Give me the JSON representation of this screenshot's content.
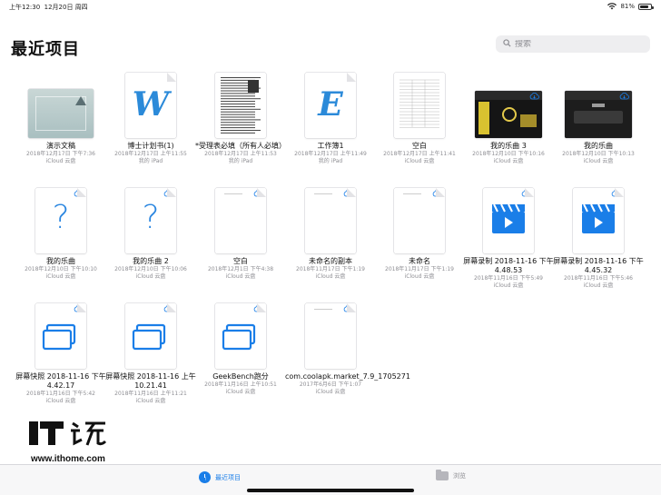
{
  "status_bar": {
    "time": "上午12:30",
    "date": "12月20日 周四",
    "battery": "81%",
    "battery_level": 0.81
  },
  "page_title": "最近项目",
  "search": {
    "placeholder": "搜索"
  },
  "files": [
    {
      "name": "演示文稿",
      "date": "2018年12月17日 下午7:36",
      "location": "iCloud 云盘",
      "thumb": "keynote"
    },
    {
      "name": "博士计划书(1)",
      "date": "2018年12月17日 上午11:55",
      "location": "我的 iPad",
      "thumb": "word",
      "glyph": "W"
    },
    {
      "name": "*受理表必填（所有人必填）",
      "date": "2018年12月17日 上午11:53",
      "location": "我的 iPad",
      "thumb": "form"
    },
    {
      "name": "工作簿1",
      "date": "2018年12月17日 上午11:49",
      "location": "我的 iPad",
      "thumb": "excel",
      "glyph": "E"
    },
    {
      "name": "空白",
      "date": "2018年12月17日 上午11:41",
      "location": "iCloud 云盘",
      "thumb": "sheet"
    },
    {
      "name": "我的乐曲 3",
      "date": "2018年12月10日 下午10:16",
      "location": "iCloud 云盘",
      "thumb": "garageband-yellow"
    },
    {
      "name": "我的乐曲",
      "date": "2018年12月10日 下午10:13",
      "location": "iCloud 云盘",
      "thumb": "garageband-dark"
    },
    {
      "name": "我的乐曲",
      "date": "2018年12月10日 下午10:10",
      "location": "iCloud 云盘",
      "thumb": "question",
      "glyph": "?"
    },
    {
      "name": "我的乐曲 2",
      "date": "2018年12月10日 下午10:06",
      "location": "iCloud 云盘",
      "thumb": "question",
      "glyph": "?"
    },
    {
      "name": "空白",
      "date": "2018年12月1日 下午4:38",
      "location": "iCloud 云盘",
      "thumb": "blank"
    },
    {
      "name": "未命名的副本",
      "date": "2018年11月17日 下午1:19",
      "location": "iCloud 云盘",
      "thumb": "blank"
    },
    {
      "name": "未命名",
      "date": "2018年11月17日 下午1:19",
      "location": "iCloud 云盘",
      "thumb": "blank"
    },
    {
      "name": "屏幕录制 2018-11-16 下午4.48.53",
      "date": "2018年11月16日 下午5:49",
      "location": "iCloud 云盘",
      "thumb": "video"
    },
    {
      "name": "屏幕录制 2018-11-16 下午4.45.32",
      "date": "2018年11月16日 下午5:46",
      "location": "iCloud 云盘",
      "thumb": "video"
    },
    {
      "name": "屏幕快照 2018-11-16 下午4.42.17",
      "date": "2018年11月16日 下午5:42",
      "location": "iCloud 云盘",
      "thumb": "screenshot"
    },
    {
      "name": "屏幕快照 2018-11-16 上午10.21.41",
      "date": "2018年11月16日 上午11:21",
      "location": "iCloud 云盘",
      "thumb": "screenshot"
    },
    {
      "name": "GeekBench跑分",
      "date": "2018年11月16日 上午10:51",
      "location": "iCloud 云盘",
      "thumb": "screenshot"
    },
    {
      "name": "com.coolapk.market_7.9_1705271",
      "date": "2017年6月6日 下午1:07",
      "location": "iCloud 云盘",
      "thumb": "blank"
    }
  ],
  "tabs": {
    "recent": "最近项目",
    "browse": "浏览"
  },
  "watermark": {
    "url": "www.ithome.com"
  },
  "colors": {
    "accent": "#1a7ee8",
    "meta_text": "#8e8e93"
  }
}
